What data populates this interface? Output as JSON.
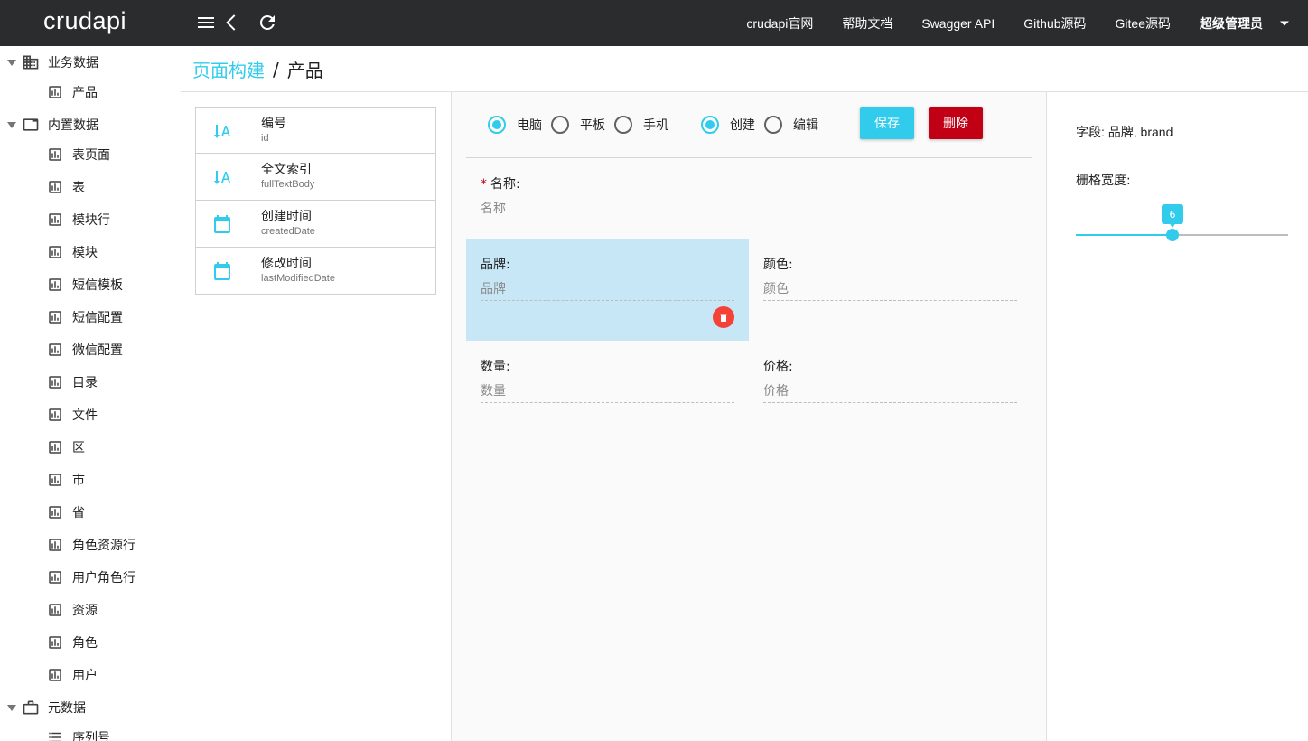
{
  "header": {
    "brand": "crudapi",
    "links": [
      "crudapi官网",
      "帮助文档",
      "Swagger API",
      "Github源码",
      "Gitee源码"
    ],
    "user": "超级管理员"
  },
  "sidebar": {
    "groups": [
      {
        "label": "业务数据",
        "icon": "building-icon",
        "items": [
          {
            "label": "产品",
            "icon": "chart-icon"
          }
        ]
      },
      {
        "label": "内置数据",
        "icon": "window-icon",
        "items": [
          {
            "label": "表页面",
            "icon": "chart-icon"
          },
          {
            "label": "表",
            "icon": "chart-icon"
          },
          {
            "label": "模块行",
            "icon": "chart-icon"
          },
          {
            "label": "模块",
            "icon": "chart-icon"
          },
          {
            "label": "短信模板",
            "icon": "chart-icon"
          },
          {
            "label": "短信配置",
            "icon": "chart-icon"
          },
          {
            "label": "微信配置",
            "icon": "chart-icon"
          },
          {
            "label": "目录",
            "icon": "chart-icon"
          },
          {
            "label": "文件",
            "icon": "chart-icon"
          },
          {
            "label": "区",
            "icon": "chart-icon"
          },
          {
            "label": "市",
            "icon": "chart-icon"
          },
          {
            "label": "省",
            "icon": "chart-icon"
          },
          {
            "label": "角色资源行",
            "icon": "chart-icon"
          },
          {
            "label": "用户角色行",
            "icon": "chart-icon"
          },
          {
            "label": "资源",
            "icon": "chart-icon"
          },
          {
            "label": "角色",
            "icon": "chart-icon"
          },
          {
            "label": "用户",
            "icon": "chart-icon"
          }
        ]
      },
      {
        "label": "元数据",
        "icon": "briefcase-icon",
        "items": [
          {
            "label": "序列号",
            "icon": "list-icon"
          }
        ]
      }
    ]
  },
  "breadcrumb": {
    "link": "页面构建",
    "separator": "/",
    "current": "产品"
  },
  "palette": {
    "fields": [
      {
        "title": "编号",
        "name": "id",
        "icon": "sort-text-icon"
      },
      {
        "title": "全文索引",
        "name": "fullTextBody",
        "icon": "sort-text-icon"
      },
      {
        "title": "创建时间",
        "name": "createdDate",
        "icon": "calendar-icon"
      },
      {
        "title": "修改时间",
        "name": "lastModifiedDate",
        "icon": "calendar-icon"
      }
    ]
  },
  "designer": {
    "device": {
      "options": [
        "电脑",
        "平板",
        "手机"
      ],
      "selected": "电脑"
    },
    "mode": {
      "options": [
        "创建",
        "编辑"
      ],
      "selected": "创建"
    },
    "save_label": "保存",
    "delete_label": "删除",
    "fields": [
      {
        "label": "名称:",
        "placeholder": "名称",
        "required": "*"
      },
      {
        "label": "品牌:",
        "placeholder": "品牌"
      },
      {
        "label": "颜色:",
        "placeholder": "颜色"
      },
      {
        "label": "数量:",
        "placeholder": "数量"
      },
      {
        "label": "价格:",
        "placeholder": "价格"
      }
    ]
  },
  "properties": {
    "field_text": "字段: 品牌, brand",
    "width_label": "栅格宽度:",
    "width_value": "6",
    "width_min": 1,
    "width_max": 12
  },
  "colors": {
    "primary": "#31ccec",
    "negative": "#c10015",
    "header_bg": "#2b2c2e",
    "selected_bg": "#c7e7f7"
  }
}
